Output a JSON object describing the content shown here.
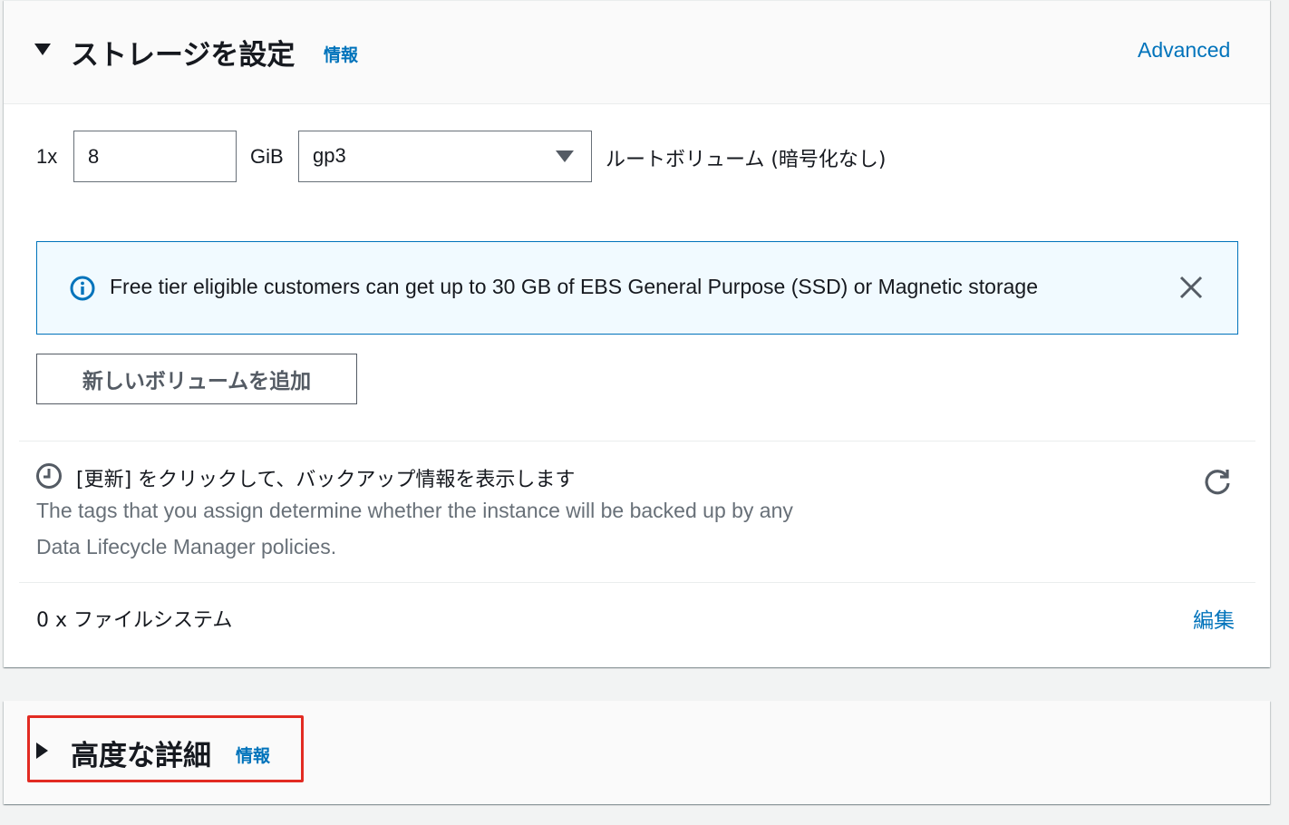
{
  "storage": {
    "title": "ストレージを設定",
    "info": "情報",
    "advanced": "Advanced",
    "volume": {
      "count": "1x",
      "size": "8",
      "unit": "GiB",
      "type": "gp3",
      "description": "ルートボリューム (暗号化なし)"
    },
    "alert": {
      "text": "Free tier eligible customers can get up to 30 GB of EBS General Purpose (SSD) or Magnetic storage"
    },
    "add_volume_button": "新しいボリュームを追加",
    "backup": {
      "title": "[更新] をクリックして、バックアップ情報を表示します",
      "description_line1": "The tags that you assign determine whether the instance will be backed up by any",
      "description_line2": "Data Lifecycle Manager policies."
    },
    "filesystems": {
      "label": "0 x ファイルシステム",
      "edit": "編集"
    }
  },
  "advanced_details": {
    "title": "高度な詳細",
    "info": "情報"
  },
  "colors": {
    "link": "#0073bb",
    "alert_border": "#0073bb",
    "alert_background": "#f1faff",
    "highlight_border": "#e22b22"
  }
}
